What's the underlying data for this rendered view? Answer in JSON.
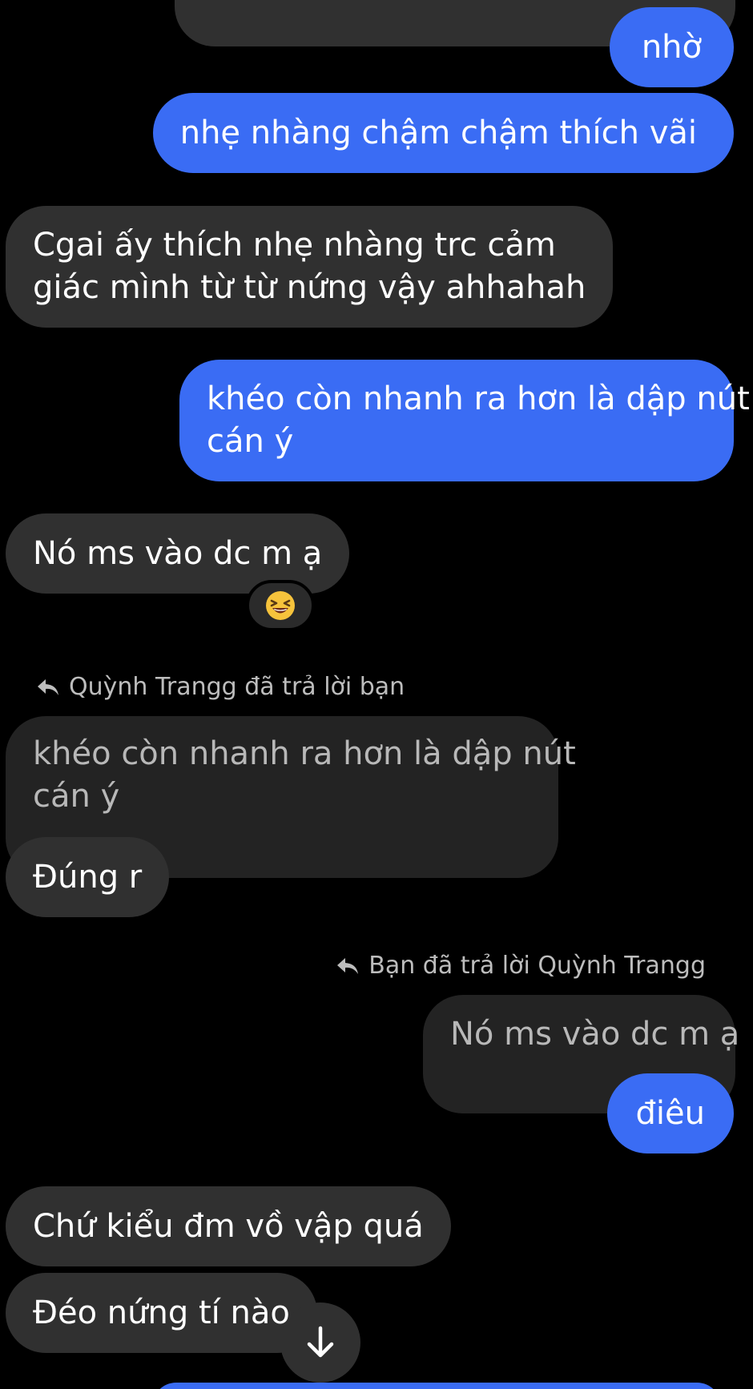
{
  "colors": {
    "background": "#000000",
    "sent_bubble": "#3a6cf4",
    "received_bubble": "#303030",
    "quoted_bubble": "#232323",
    "reply_note_text": "#bdbdbd"
  },
  "messages": {
    "m1": {
      "text": "nhờ",
      "sender": "me"
    },
    "m2": {
      "text": "nhẹ nhàng chậm chậm thích vãi",
      "sender": "me"
    },
    "m3": {
      "line1": "Cgai ấy thích nhẹ nhàng trc cảm",
      "line2": "giác mình từ từ nứng vậy ahhahah",
      "sender": "other"
    },
    "m4": {
      "line1": "khéo còn nhanh ra hơn là dập nút",
      "line2": "cán ý",
      "sender": "me"
    },
    "m5": {
      "text": "Nó ms vào dc m ạ",
      "sender": "other",
      "reaction": "😆",
      "reaction_icon": "laughing-face-icon"
    },
    "reply1": {
      "note": "Quỳnh Trangg đã trả lời bạn",
      "quoted_line1": "khéo còn nhanh ra hơn là dập nút",
      "quoted_line2": "cán ý",
      "text": "Đúng r"
    },
    "reply2": {
      "note": "Bạn đã trả lời Quỳnh Trangg",
      "quoted": "Nó ms vào dc m ạ",
      "text": "điêu"
    },
    "m6": {
      "text": "Chứ kiểu đm vồ vập quá",
      "sender": "other"
    },
    "m7": {
      "text": "Đéo nứng tí nào",
      "sender": "other"
    }
  },
  "controls": {
    "scroll_down_icon": "arrow-down-icon"
  }
}
